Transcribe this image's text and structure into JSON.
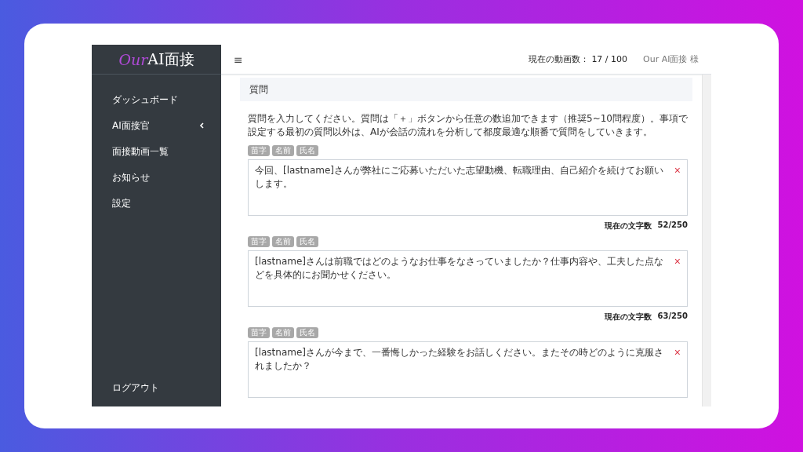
{
  "sidebar": {
    "logo": {
      "accent": "Our",
      "rest": "AI面接"
    },
    "items": [
      {
        "label": "ダッシュボード",
        "expandable": false
      },
      {
        "label": "AI面接官",
        "expandable": true
      },
      {
        "label": "面接動画一覧",
        "expandable": false
      },
      {
        "label": "お知らせ",
        "expandable": false
      },
      {
        "label": "設定",
        "expandable": false
      }
    ],
    "footer_item": "ログアウト"
  },
  "close_glyph": "×",
  "topbar": {
    "menu_glyph": "≡",
    "video_count_label": "現在の動画数：",
    "video_count": "17 / 100",
    "user": "Our AI面接 様"
  },
  "section": {
    "title": "質問",
    "description": "質問を入力してください。質問は「＋」ボタンから任意の数追加できます（推奨5~10問程度）。事項で設定する最初の質問以外は、AIが会話の流れを分析して都度最適な順番で質問をしていきます。",
    "questions": [
      {
        "tags": [
          "苗字",
          "名前",
          "氏名"
        ],
        "text": "今回、[lastname]さんが弊社にご応募いただいた志望動機、転職理由、自己紹介を続けてお願いします。",
        "count_label": "現在の文字数",
        "count": "52/250"
      },
      {
        "tags": [
          "苗字",
          "名前",
          "氏名"
        ],
        "text": "[lastname]さんは前職ではどのようなお仕事をなさっていましたか？仕事内容や、工夫した点などを具体的にお聞かせください。",
        "count_label": "現在の文字数",
        "count": "63/250"
      },
      {
        "tags": [
          "苗字",
          "名前",
          "氏名"
        ],
        "text": "[lastname]さんが今まで、一番悔しかった経験をお話しください。またその時どのように克服されましたか？"
      }
    ]
  }
}
